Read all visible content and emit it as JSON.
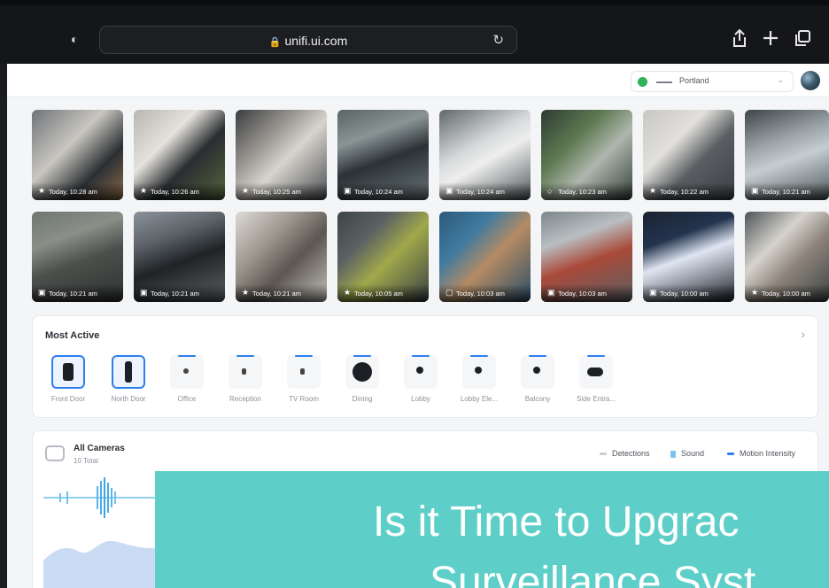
{
  "browser": {
    "url": "unifi.ui.com",
    "icons": [
      "shield-icon",
      "lock-icon",
      "reload-icon",
      "share-icon",
      "new-tab-icon",
      "tabs-icon"
    ]
  },
  "header": {
    "site_name": "Portland",
    "status_color": "#2fb15a"
  },
  "recent_events": [
    {
      "time": "Today, 10:28 am",
      "icon": "person-icon"
    },
    {
      "time": "Today, 10:26 am",
      "icon": "person-icon"
    },
    {
      "time": "Today, 10:25 am",
      "icon": "person-icon"
    },
    {
      "time": "Today, 10:24 am",
      "icon": "vehicle-icon"
    },
    {
      "time": "Today, 10:24 am",
      "icon": "vehicle-icon"
    },
    {
      "time": "Today, 10:23 am",
      "icon": "animal-icon"
    },
    {
      "time": "Today, 10:22 am",
      "icon": "person-icon"
    },
    {
      "time": "Today, 10:21 am",
      "icon": "vehicle-icon"
    },
    {
      "time": "Today, 10:21 am",
      "icon": "vehicle-icon"
    },
    {
      "time": "Today, 10:21 am",
      "icon": "vehicle-icon"
    },
    {
      "time": "Today, 10:21 am",
      "icon": "person-icon"
    },
    {
      "time": "Today, 10:05 am",
      "icon": "person-icon"
    },
    {
      "time": "Today, 10:03 am",
      "icon": "package-icon"
    },
    {
      "time": "Today, 10:03 am",
      "icon": "vehicle-icon"
    },
    {
      "time": "Today, 10:00 am",
      "icon": "vehicle-icon"
    },
    {
      "time": "Today, 10:00 am",
      "icon": "person-icon"
    }
  ],
  "most_active": {
    "title": "Most Active",
    "cameras": [
      {
        "name": "Front Door"
      },
      {
        "name": "North Door"
      },
      {
        "name": "Office"
      },
      {
        "name": "Reception"
      },
      {
        "name": "TV Room"
      },
      {
        "name": "Dining"
      },
      {
        "name": "Lobby"
      },
      {
        "name": "Lobby Ele..."
      },
      {
        "name": "Balcony"
      },
      {
        "name": "Side Entra..."
      }
    ]
  },
  "all_cameras": {
    "title": "All Cameras",
    "subtitle": "10 Total",
    "legend": [
      {
        "label": "Detections",
        "color": "#c9ccd2"
      },
      {
        "label": "Sound",
        "color": "#7cc3ef"
      },
      {
        "label": "Motion Intensity",
        "color": "#2e7ef0"
      }
    ]
  },
  "banner": {
    "line1": "Is it Time to Upgrac",
    "line2": "Surveillance Syst"
  }
}
